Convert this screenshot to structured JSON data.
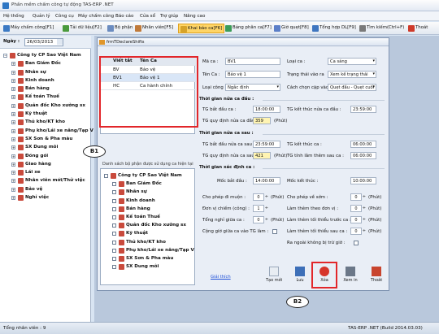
{
  "window": {
    "title": "Phần mềm chấm công tự động TAS-ERP .NET"
  },
  "menu": [
    "Hệ thống",
    "Quản lý",
    "Công cụ",
    "Máy chấm công",
    "Báo cáo",
    "Cửa sổ",
    "Trợ giúp",
    "Nâng cao"
  ],
  "toolbar": [
    "Máy chấm công[F1]",
    "Tải dữ liệu[F2]",
    "Bộ phận",
    "Nhân viên[F5]",
    "Khai báo ca[F6]",
    "Bảng phân ca[F7]",
    "Giờ quẹt[F8]",
    "Tổng hợp DL[F9]",
    "Tìm kiếm(Ctrl+F)",
    "Thoát"
  ],
  "left": {
    "date_label": "Ngày :",
    "date_value": "26/03/2013",
    "tree": [
      "Công ty CP Sao Việt Nam",
      "Ban Giám Đốc",
      "Nhân sự",
      "Kinh doanh",
      "Bán hàng",
      "Kế toán Thuế",
      "Quản đốc Kho xưởng sx",
      "Kỹ thuật",
      "Thủ kho/KT kho",
      "Phụ kho/Lái xe nâng/Tạp V",
      "SX Sơn & Pha màu",
      "SX Dung môi",
      "Đóng gói",
      "Giao hàng",
      "Lái xe",
      "Nhân viên mới/Thử việc",
      "Bảo vệ",
      "Nghỉ việc"
    ]
  },
  "form": {
    "title": "frmTDeclareShifts",
    "grid": {
      "headers": [
        "Viết tắt",
        "Tên Ca"
      ],
      "rows": [
        [
          "BV",
          "Bảo vệ"
        ],
        [
          "BV1",
          "Bảo vệ 1"
        ],
        [
          "HC",
          "Ca hành chính"
        ]
      ]
    },
    "dept_caption": "Danh sách bộ phận được sử dụng ca hiện tại",
    "dept_tree": [
      "Công ty CP Sao Việt Nam",
      "Ban Giám Đốc",
      "Nhân sự",
      "Kinh doanh",
      "Bán hàng",
      "Kế toán Thuế",
      "Quản đốc Kho xưởng sx",
      "Kỹ thuật",
      "Thủ kho/KT kho",
      "Phụ kho/Lái xe nâng/Tạp V",
      "SX Sơn & Pha màu",
      "SX Dung môi"
    ],
    "labels": {
      "ma_ca": "Mã ca :",
      "ma_ca_val": "BV1",
      "loai_ca": "Loại ca :",
      "loai_ca_val": "Ca sáng",
      "ten_ca": "Tên Ca :",
      "ten_ca_val": "Bảo vệ 1",
      "trang_thai": "Trạng thái vào ra",
      "trang_thai_val": "Xem kế trạng thái",
      "loai_cong": "Loại công",
      "loai_cong_val": "Ngắc định",
      "cach_chon": "Cách chọn cặp vào ra",
      "cach_chon_val": "Quẹt đầu - Quẹt cuối",
      "sec1": "Thời gian nửa ca đầu :",
      "tg_bd1": "TG bắt đầu ca :",
      "tg_bd1_val": "18:00:00",
      "tg_kt1": "TG kết thúc nửa ca đầu :",
      "tg_kt1_val": "23:59:00",
      "tg_qd1": "TG quy định nửa ca đầu :",
      "tg_qd1_val": "359",
      "phut": "(Phút)",
      "sec2": "Thời gian nửa ca sau :",
      "tg_bd2": "TG bắt đầu nửa ca sau :",
      "tg_bd2_val": "23:59:00",
      "tg_kt2": "TG kết thúc ca :",
      "tg_kt2_val": "06:00:00",
      "tg_qd2": "TG quy định nửa ca sau :",
      "tg_qd2_val": "421",
      "tg_tl": "TG tính lâm thêm sau ca :",
      "tg_tl_val": "06:00:00",
      "sec3": "Thời gian xác định ca :",
      "moc_bd": "Mốc bắt đầu :",
      "moc_bd_val": "14:00:00",
      "moc_kt": "Mốc kết thúc :",
      "moc_kt_val": "10:00:00",
      "cp_tre": "Cho phép đi muộn :",
      "cp_tre_val": "0",
      "cp_som": "Cho phép về sớm :",
      "cp_som_val": "0",
      "dv_chiem": "Đơn vị chiếm (công) :",
      "dv_chiem_val": "1",
      "lt_dm": "Làm thêm theo đơn vị :",
      "lt_dm_val": "0",
      "tong_ngi": "Tổng nghỉ giữa ca :",
      "tong_ngi_val": "0",
      "lt_toi_thieu_truoc": "Làm thêm tối thiểu trước ca :",
      "lt_toi_thieu_truoc_val": "0",
      "cong_ghi": "Cộng giờ giữa ca vào TG làm :",
      "lt_toi_thieu_sau": "Làm thêm tối thiểu sau ca :",
      "lt_toi_thieu_sau_val": "0",
      "ra_ngoai": "Ra ngoài không bị trừ giờ :",
      "giai_thich": "Giải thích"
    },
    "buttons": [
      "Tạo mới",
      "Lưu",
      "Xóa",
      "Xem in",
      "Thoát"
    ]
  },
  "callouts": {
    "b1": "B1",
    "b2": "B2"
  },
  "status": {
    "left": "Tổng nhân viên : 9",
    "right": "TAS-ERP .NET (Build 2014.03.03)"
  }
}
